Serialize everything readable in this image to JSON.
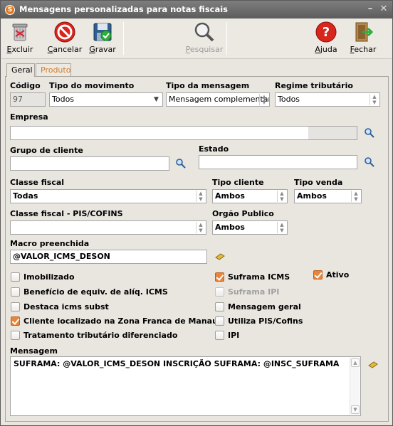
{
  "window": {
    "title": "Mensagens personalizadas para notas fiscais",
    "app_icon": "S"
  },
  "toolbar": {
    "excluir": {
      "pre": "",
      "u": "E",
      "post": "xcluir"
    },
    "cancelar": {
      "pre": "",
      "u": "C",
      "post": "ancelar"
    },
    "gravar": {
      "pre": "",
      "u": "G",
      "post": "ravar"
    },
    "pesquisar": {
      "pre": "",
      "u": "P",
      "post": "esquisar"
    },
    "ajuda": {
      "pre": "",
      "u": "A",
      "post": "juda"
    },
    "fechar": {
      "pre": "",
      "u": "F",
      "post": "echar"
    }
  },
  "tabs": [
    "Geral",
    "Produto"
  ],
  "form": {
    "codigo": {
      "label": "Código",
      "value": "97"
    },
    "tipo_movimento": {
      "label": "Tipo do movimento",
      "value": "Todos"
    },
    "tipo_mensagem": {
      "label": "Tipo da mensagem",
      "value": "Mensagem complementar"
    },
    "regime_tributario": {
      "label": "Regime tributário",
      "value": "Todos"
    },
    "empresa": {
      "label": "Empresa",
      "value": ""
    },
    "grupo_cliente": {
      "label": "Grupo de cliente",
      "value": ""
    },
    "estado": {
      "label": "Estado",
      "value": ""
    },
    "classe_fiscal": {
      "label": "Classe fiscal",
      "value": "Todas"
    },
    "tipo_cliente": {
      "label": "Tipo cliente",
      "value": "Ambos"
    },
    "tipo_venda": {
      "label": "Tipo venda",
      "value": "Ambos"
    },
    "classe_fiscal_pis": {
      "label": "Classe fiscal - PIS/COFINS",
      "value": ""
    },
    "orgao_publico": {
      "label": "Orgão Publico",
      "value": "Ambos"
    },
    "macro": {
      "label": "Macro preenchida",
      "value": "@VALOR_ICMS_DESON"
    },
    "mensagem": {
      "label": "Mensagem",
      "value": "SUFRAMA: @VALOR_ICMS_DESON INSCRIÇÃO SUFRAMA: @INSC_SUFRAMA"
    }
  },
  "checkboxes": {
    "imobilizado": {
      "label": "Imobilizado",
      "checked": false
    },
    "beneficio": {
      "label": "Benefício de equiv. de alíq. ICMS",
      "checked": false
    },
    "destaca": {
      "label": "Destaca icms subst",
      "checked": false
    },
    "zona_franca": {
      "label": "Cliente localizado na Zona Franca de Manaus",
      "checked": true
    },
    "tratamento": {
      "label": "Tratamento tributário diferenciado",
      "checked": false
    },
    "suframa_icms": {
      "label": "Suframa ICMS",
      "checked": true
    },
    "suframa_ipi": {
      "label": "Suframa IPI",
      "checked": false
    },
    "mensagem_geral": {
      "label": "Mensagem geral",
      "checked": false
    },
    "utiliza_pis": {
      "label": "Utiliza PIS/Cofins",
      "checked": false
    },
    "ipi": {
      "label": "IPI",
      "checked": false
    },
    "ativo": {
      "label": "Ativo",
      "checked": true
    }
  },
  "colors": {
    "accent": "#e9853b",
    "tab_inactive": "#d67b29"
  }
}
